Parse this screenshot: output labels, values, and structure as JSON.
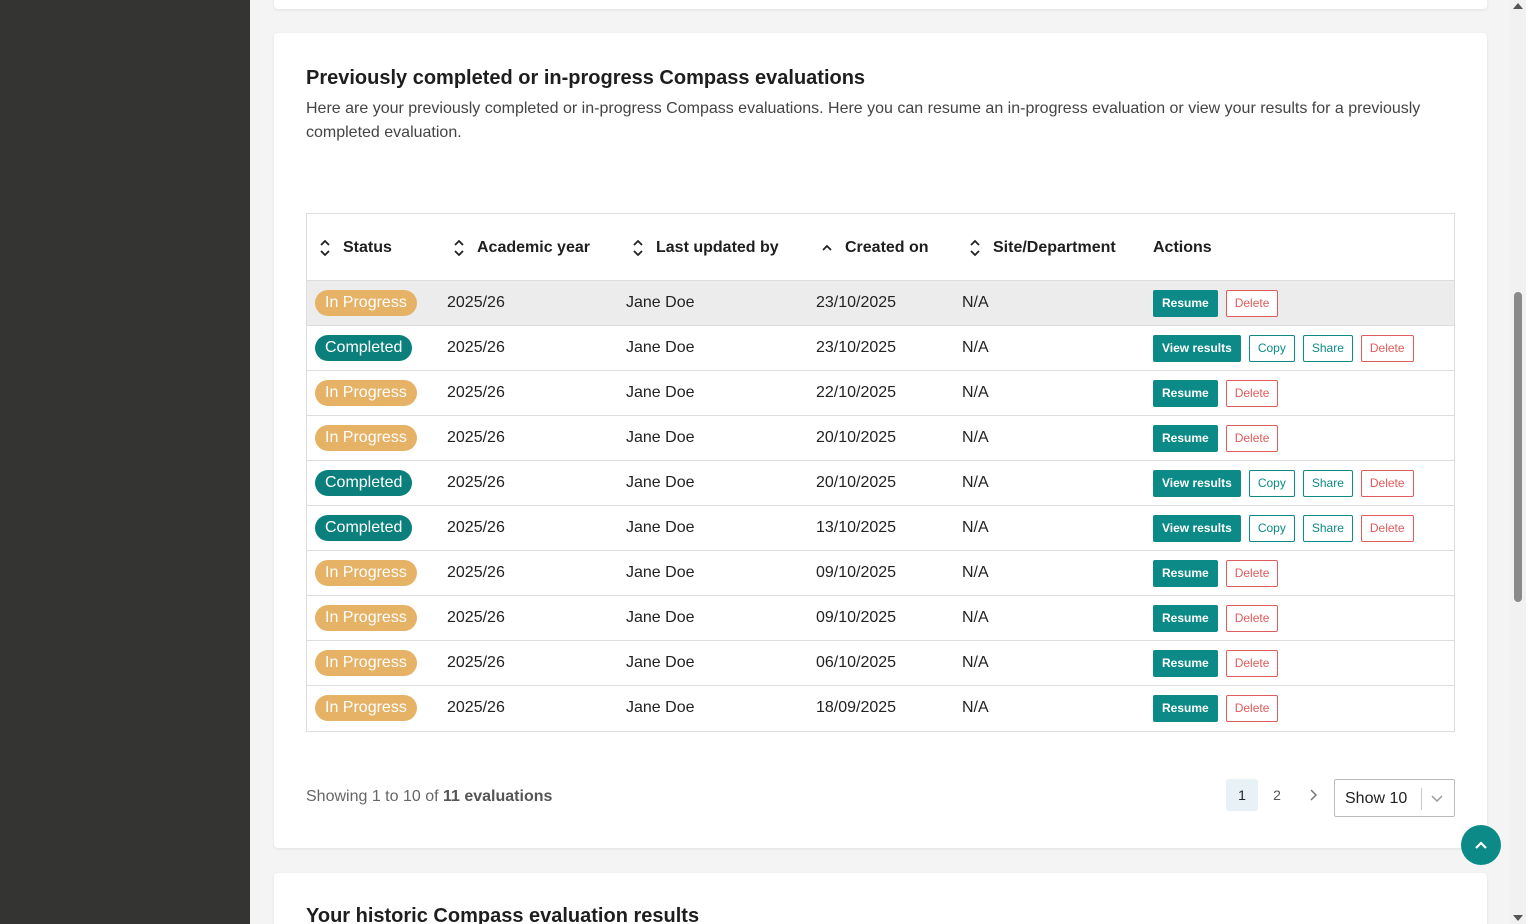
{
  "section": {
    "title": "Previously completed or in-progress Compass evaluations",
    "description": "Here are your previously completed or in-progress Compass evaluations. Here you can resume an in-progress evaluation or view your results for a previously completed evaluation."
  },
  "table": {
    "columns": {
      "status": "Status",
      "academic_year": "Academic year",
      "last_updated_by": "Last updated by",
      "created_on": "Created on",
      "site": "Site/Department",
      "actions": "Actions"
    },
    "rows": [
      {
        "status": "In Progress",
        "year": "2025/26",
        "by": "Jane Doe",
        "created": "23/10/2025",
        "site": "N/A"
      },
      {
        "status": "Completed",
        "year": "2025/26",
        "by": "Jane Doe",
        "created": "23/10/2025",
        "site": "N/A"
      },
      {
        "status": "In Progress",
        "year": "2025/26",
        "by": "Jane Doe",
        "created": "22/10/2025",
        "site": "N/A"
      },
      {
        "status": "In Progress",
        "year": "2025/26",
        "by": "Jane Doe",
        "created": "20/10/2025",
        "site": "N/A"
      },
      {
        "status": "Completed",
        "year": "2025/26",
        "by": "Jane Doe",
        "created": "20/10/2025",
        "site": "N/A"
      },
      {
        "status": "Completed",
        "year": "2025/26",
        "by": "Jane Doe",
        "created": "13/10/2025",
        "site": "N/A"
      },
      {
        "status": "In Progress",
        "year": "2025/26",
        "by": "Jane Doe",
        "created": "09/10/2025",
        "site": "N/A"
      },
      {
        "status": "In Progress",
        "year": "2025/26",
        "by": "Jane Doe",
        "created": "09/10/2025",
        "site": "N/A"
      },
      {
        "status": "In Progress",
        "year": "2025/26",
        "by": "Jane Doe",
        "created": "06/10/2025",
        "site": "N/A"
      },
      {
        "status": "In Progress",
        "year": "2025/26",
        "by": "Jane Doe",
        "created": "18/09/2025",
        "site": "N/A"
      }
    ],
    "actions": {
      "resume": "Resume",
      "delete": "Delete",
      "view_results": "View results",
      "copy": "Copy",
      "share": "Share"
    }
  },
  "footer": {
    "showing_prefix": "Showing 1 to 10 of",
    "showing_count": "11 evaluations",
    "pages": [
      "1",
      "2"
    ],
    "current_page": "1",
    "page_size": "Show 10"
  },
  "next_section": {
    "title": "Your historic Compass evaluation results"
  },
  "colors": {
    "primary": "#0b8a87",
    "in_progress": "#e6b266",
    "completed": "#0a7f7c",
    "danger": "#e05b5b",
    "sidebar": "#343432"
  },
  "icons": [
    "sort-icon",
    "sort-up-icon",
    "chevron-right-icon",
    "chevron-down-icon",
    "chevron-up-icon"
  ]
}
